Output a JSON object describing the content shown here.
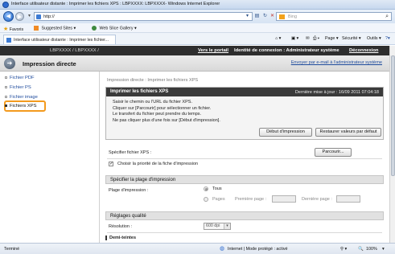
{
  "window": {
    "title": "Interface utilisateur distante : Imprimer les fichiers XPS : LBPXXXX: LBPXXXX- Windows Internet Explorer"
  },
  "browser": {
    "address": "http://",
    "search_placeholder": "Bing",
    "favorites_label": "Favoris",
    "suggested_sites": "Suggested Sites ▾",
    "web_slice": "Web Slice Gallery ▾",
    "tab_title": "Interface utilisateur distante : Imprimer les fichier...",
    "cmd_page": "Page ▾",
    "cmd_security": "Sécurité ▾",
    "cmd_tools": "Outils ▾"
  },
  "device": {
    "name": "LBPXXXX / LBPXXXX /",
    "portal_link": "Vers le portail",
    "login_id": "Identité de connexion : Administrateur système",
    "logout": "Déconnexion",
    "page_title": "Impression directe",
    "mail_link": "Envoyer par e-mail à l'administrateur système"
  },
  "sidebar": {
    "items": [
      {
        "label": "Fichier PDF"
      },
      {
        "label": "Fichier PS"
      },
      {
        "label": "Fichier image"
      },
      {
        "label": "Fichiers XPS"
      }
    ],
    "active_index": 3
  },
  "content": {
    "breadcrumb": "Impression directe : Imprimer les fichiers XPS",
    "panel": {
      "title": "Imprimer les fichiers XPS",
      "updated": "Dernière mise à jour : 16/09 2011 07:04:18",
      "lines": [
        "Saisir le chemin ou l'URL du fichier XPS.",
        "Cliquer sur [Parcourir] pour sélectionner un fichier.",
        "Le transfert du fichier peut prendre du temps.",
        "Ne pas cliquer plus d'une fois sur [Début d'impression]."
      ],
      "start_button": "Début d'impression",
      "reset_button": "Restaurer valeurs par défaut"
    },
    "file": {
      "label": "Spécifier fichier XPS :",
      "browse_button": "Parcourir...",
      "priority_label": "Choisir la priorité de la fiche d'impression",
      "priority_checked": true
    },
    "range": {
      "heading": "Spécifier la plage d'impression",
      "label": "Plage d'impression :",
      "option_all": "Tous",
      "option_pages": "Pages",
      "first_page_label": "Première page :",
      "last_page_label": "Dernière page :",
      "selected": "Tous"
    },
    "quality": {
      "heading": "Réglages qualité",
      "resolution_label": "Résolution :",
      "resolution_value": "600 dpi"
    },
    "halftone_heading": "Demi-teintes"
  },
  "status": {
    "left": "Terminé",
    "zone": "Internet | Mode protégé : activé",
    "zoom": "100%"
  },
  "colors": {
    "highlight": "#f39a1e",
    "header_dark": "#2e2e2e",
    "link": "#1d4a9c"
  }
}
